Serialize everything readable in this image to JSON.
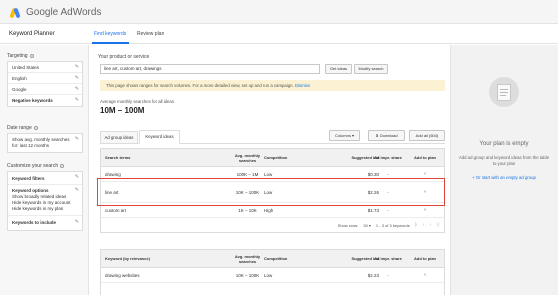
{
  "app": {
    "brand": "Google",
    "product": "AdWords"
  },
  "page": {
    "title": "Keyword Planner"
  },
  "top_tabs": {
    "find": "Find keywords",
    "review": "Review plan"
  },
  "sidebar": {
    "targeting_label": "Targeting",
    "targeting_items": [
      "United States",
      "English",
      "Google",
      "Negative keywords"
    ],
    "date_range_label": "Date range",
    "date_range_text": [
      "Show avg. monthly searches",
      "for: last 12 months"
    ],
    "customize_label": "Customize your search",
    "keyword_filters": "Keyword filters",
    "keyword_options_title": "Keyword options",
    "keyword_options_lines": [
      "Show broadly related ideas",
      "Hide keywords in my account",
      "Hide keywords in my plan"
    ],
    "keywords_to_include": "Keywords to include"
  },
  "search": {
    "label": "Your product or service",
    "value": "line art, custom art, drawings",
    "get_ideas": "Get ideas",
    "modify_search": "Modify search"
  },
  "notice": {
    "text": "This page shows ranges for search volumes. For a more detailed view, set up and run a campaign.",
    "dismiss": "Dismiss"
  },
  "summary": {
    "label": "Average monthly searches for all ideas",
    "value": "10M – 100M"
  },
  "result_tabs": {
    "ad_group": "Ad group ideas",
    "keyword": "Keyword ideas"
  },
  "toolbar": {
    "columns": "Columns ▾",
    "download": "Download",
    "add_all": "Add all (604)"
  },
  "table1": {
    "headers": {
      "term": "Search terms",
      "avg": "Avg. monthly searches",
      "comp": "Competition",
      "bid": "Suggested bid",
      "share": "Ad impr. share",
      "add": "Add to plan"
    },
    "rows": [
      {
        "term": "drawing",
        "avg": "100K – 1M",
        "comp": "Low",
        "bid": "$0.30",
        "share": "–"
      },
      {
        "term": "line art",
        "avg": "10K – 100K",
        "comp": "Low",
        "bid": "$2.26",
        "share": "–"
      },
      {
        "term": "custom art",
        "avg": "1K – 10K",
        "comp": "High",
        "bid": "$1.73",
        "share": "–"
      }
    ],
    "footer": {
      "show_rows_label": "Show rows:",
      "show_rows_value": "30",
      "range": "1 - 3 of 3 keywords"
    }
  },
  "table2": {
    "headers": {
      "term": "Keyword (by relevance)",
      "avg": "Avg. monthly searches",
      "comp": "Competition",
      "bid": "Suggested bid",
      "share": "Ad impr. share",
      "add": "Add to plan"
    },
    "rows": [
      {
        "term": "drawing websites",
        "avg": "10K – 100K",
        "comp": "Low",
        "bid": "$2.23",
        "share": "–"
      },
      {
        "term": "",
        "avg": "",
        "comp": "",
        "bid": "",
        "share": ""
      }
    ]
  },
  "plan": {
    "empty_title": "Your plan is empty",
    "hint": "Add ad group and keyword ideas from the table to your plan",
    "start": "+ Or start with an empty ad group"
  },
  "colors": {
    "accent": "#1a73e8",
    "highlight": "#e0443e",
    "notice_bg": "#fcf1d2"
  }
}
